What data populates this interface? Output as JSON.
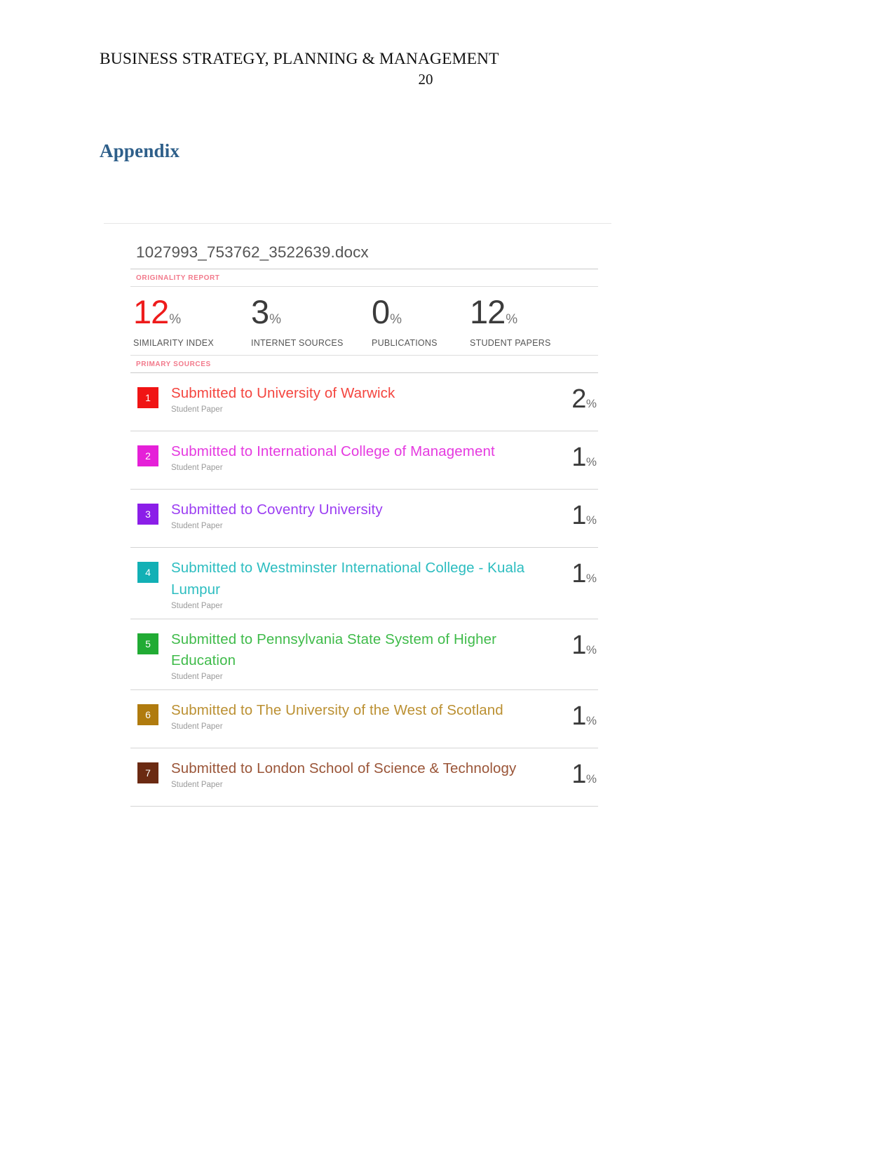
{
  "page": {
    "running_head": "BUSINESS STRATEGY, PLANNING & MANAGEMENT",
    "page_number": "20",
    "heading": "Appendix",
    "heading_color": "#2e5f8a"
  },
  "report": {
    "filename": "1027993_753762_3522639.docx",
    "originality_label": "ORIGINALITY REPORT",
    "primary_sources_label": "PRIMARY SOURCES",
    "label_color": "#f2798b",
    "stats": [
      {
        "value": "12",
        "percent_symbol": "%",
        "label": "SIMILARITY INDEX",
        "color": "#ee1b1b",
        "accent": true
      },
      {
        "value": "3",
        "percent_symbol": "%",
        "label": "INTERNET SOURCES",
        "color": "#3b3b3b",
        "accent": false
      },
      {
        "value": "0",
        "percent_symbol": "%",
        "label": "PUBLICATIONS",
        "color": "#3b3b3b",
        "accent": false
      },
      {
        "value": "12",
        "percent_symbol": "%",
        "label": "STUDENT PAPERS",
        "color": "#3b3b3b",
        "accent": false
      }
    ],
    "sources": [
      {
        "rank": "1",
        "title": "Submitted to University of Warwick",
        "type": "Student Paper",
        "percent": "2",
        "percent_symbol": "%",
        "badge_color": "#f01414",
        "text_color": "#f4453f"
      },
      {
        "rank": "2",
        "title": "Submitted to International College of Management",
        "type": "Student Paper",
        "percent": "1",
        "percent_symbol": "%",
        "badge_color": "#e520d8",
        "text_color": "#e53ae0"
      },
      {
        "rank": "3",
        "title": "Submitted to Coventry University",
        "type": "Student Paper",
        "percent": "1",
        "percent_symbol": "%",
        "badge_color": "#8b1ee8",
        "text_color": "#9b3df2"
      },
      {
        "rank": "4",
        "title": "Submitted to Westminster International College - Kuala Lumpur",
        "type": "Student Paper",
        "percent": "1",
        "percent_symbol": "%",
        "badge_color": "#12b0b5",
        "text_color": "#2cbdc0"
      },
      {
        "rank": "5",
        "title": "Submitted to Pennsylvania State System of Higher Education",
        "type": "Student Paper",
        "percent": "1",
        "percent_symbol": "%",
        "badge_color": "#21ab34",
        "text_color": "#3fbb4a"
      },
      {
        "rank": "6",
        "title": "Submitted to The University of the West of Scotland",
        "type": "Student Paper",
        "percent": "1",
        "percent_symbol": "%",
        "badge_color": "#b07b0e",
        "text_color": "#bb9032"
      },
      {
        "rank": "7",
        "title": "Submitted to London School of Science & Technology",
        "type": "Student Paper",
        "percent": "1",
        "percent_symbol": "%",
        "badge_color": "#6b2a12",
        "text_color": "#9a5538"
      }
    ]
  }
}
